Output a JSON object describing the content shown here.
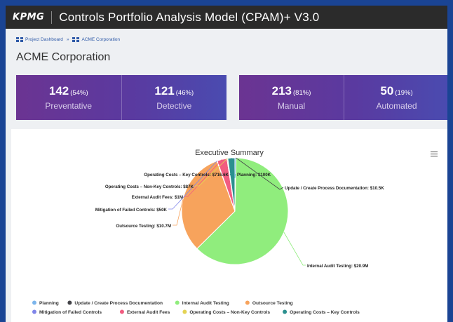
{
  "header": {
    "logo": "KPMG",
    "title": "Controls Portfolio Analysis Model (CPAM)+ V3.0"
  },
  "breadcrumb": {
    "items": [
      "Project Dashboard",
      "ACME Corporation"
    ],
    "separator": "»"
  },
  "page": {
    "title": "ACME Corporation"
  },
  "stats": [
    {
      "value": "142",
      "pct": "(54%)",
      "label": "Preventative"
    },
    {
      "value": "121",
      "pct": "(46%)",
      "label": "Detective"
    },
    {
      "value": "213",
      "pct": "(81%)",
      "label": "Manual"
    },
    {
      "value": "50",
      "pct": "(19%)",
      "label": "Automated"
    }
  ],
  "chart_menu_icon": "hamburger-menu-icon",
  "chart_data": {
    "type": "pie",
    "title": "Executive Summary",
    "legend_placement": "bottom",
    "series": [
      {
        "name": "Planning",
        "value": 0.1,
        "label": "Planning: $100K",
        "color": "#7cb5ec"
      },
      {
        "name": "Update / Create Process Documentation",
        "value": 0.0105,
        "label": "Update / Create Process Documentation: $10.5K",
        "color": "#434348"
      },
      {
        "name": "Internal Audit Testing",
        "value": 20.9,
        "label": "Internal Audit Testing: $20.9M",
        "color": "#90ed7d"
      },
      {
        "name": "Outsource Testing",
        "value": 10.7,
        "label": "Outsource Testing: $10.7M",
        "color": "#f7a35c"
      },
      {
        "name": "Mitigation of Failed Controls",
        "value": 0.05,
        "label": "Mitigation of Failed Controls: $50K",
        "color": "#8085e9"
      },
      {
        "name": "External Audit Fees",
        "value": 1.0,
        "label": "External Audit Fees: $1M",
        "color": "#f15c80"
      },
      {
        "name": "Operating Costs - Non-Key Controls",
        "value": 0.087,
        "label": "Operating Costs – Non-Key Controls: $87K",
        "color": "#e4d354"
      },
      {
        "name": "Operating Costs - Key Controls",
        "value": 0.7166,
        "label": "Operating Costs – Key Controls: $716.6K",
        "color": "#2b908f"
      }
    ],
    "legend": [
      [
        "Planning",
        "Update / Create Process Documentation",
        "Internal Audit Testing",
        "Outsource Testing"
      ],
      [
        "Mitigation of Failed Controls",
        "External Audit Fees",
        "Operating Costs – Non-Key Controls",
        "Operating Costs – Key Controls"
      ]
    ]
  }
}
